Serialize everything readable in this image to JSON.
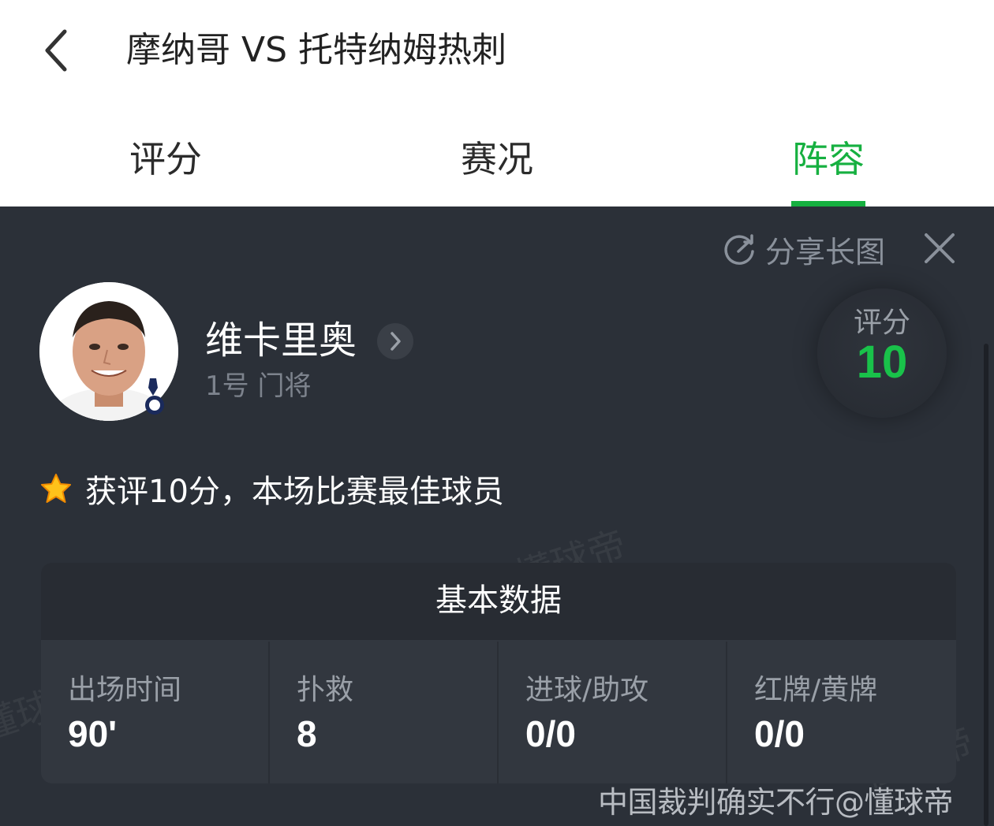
{
  "header": {
    "title": "摩纳哥 VS 托特纳姆热刺",
    "tabs": [
      {
        "label": "评分"
      },
      {
        "label": "赛况"
      },
      {
        "label": "阵容",
        "active": true
      }
    ]
  },
  "colors": {
    "accent": "#16b040",
    "panel_bg": "#2b3038",
    "rating": "#19c24a"
  },
  "panel": {
    "share_label": "分享长图",
    "player": {
      "name": "维卡里奥",
      "meta": "1号 门将"
    },
    "rating": {
      "label": "评分",
      "value": "10"
    },
    "award_text": "获评10分，本场比赛最佳球员",
    "stats": {
      "title": "基本数据",
      "items": [
        {
          "label": "出场时间",
          "value": "90'"
        },
        {
          "label": "扑救",
          "value": "8"
        },
        {
          "label": "进球/助攻",
          "value": "0/0"
        },
        {
          "label": "红牌/黄牌",
          "value": "0/0"
        }
      ]
    },
    "watermark": "懂球帝",
    "footer_watermark": "中国裁判确实不行@懂球帝"
  },
  "icons": {
    "back": "chevron-left-icon",
    "share": "share-icon",
    "close": "close-icon",
    "name_arrow": "chevron-right-icon",
    "award": "star-icon",
    "team_badge": "team-badge-icon"
  }
}
